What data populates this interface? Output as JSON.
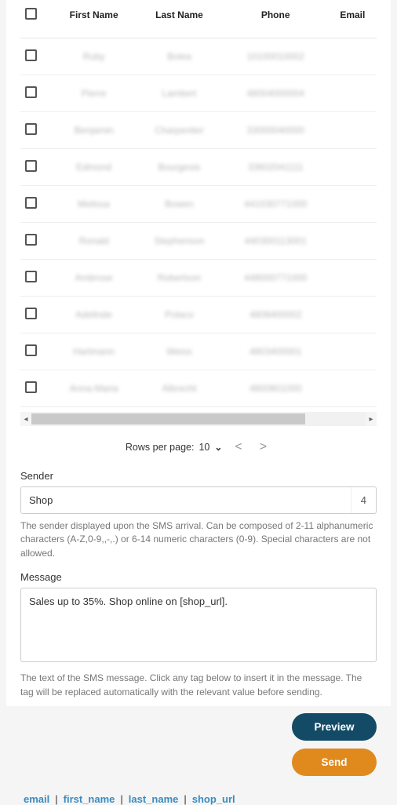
{
  "table": {
    "headers": {
      "first_name": "First Name",
      "last_name": "Last Name",
      "phone": "Phone",
      "email": "Email"
    },
    "rows": [
      {
        "first": "Ruby",
        "last": "Bolea",
        "phone": "10100010002",
        "email": ""
      },
      {
        "first": "Pierre",
        "last": "Lambert",
        "phone": "48004000004",
        "email": ""
      },
      {
        "first": "Benjamin",
        "last": "Charpentier",
        "phone": "33000040000",
        "email": ""
      },
      {
        "first": "Edmond",
        "last": "Bourgeois",
        "phone": "33602041111",
        "email": ""
      },
      {
        "first": "Melissa",
        "last": "Bowen",
        "phone": "441030771000",
        "email": ""
      },
      {
        "first": "Ronald",
        "last": "Stephenson",
        "phone": "440300113001",
        "email": ""
      },
      {
        "first": "Ambrose",
        "last": "Robertson",
        "phone": "448000771000",
        "email": ""
      },
      {
        "first": "Adelinde",
        "last": "Polaco",
        "phone": "4808400002",
        "email": ""
      },
      {
        "first": "Hartmann",
        "last": "Weiss",
        "phone": "4803400001",
        "email": ""
      },
      {
        "first": "Anna-Maria",
        "last": "Albrecht",
        "phone": "4800801000",
        "email": ""
      }
    ]
  },
  "pagination": {
    "rows_label": "Rows per page:",
    "rows_value": "10"
  },
  "sender": {
    "label": "Sender",
    "value": "Shop",
    "counter": "4",
    "help": "The sender displayed upon the SMS arrival. Can be composed of 2-11 alphanumeric characters (A-Z,0-9,,-,.) or 6-14 numeric characters (0-9). Special characters are not allowed."
  },
  "message": {
    "label": "Message",
    "value": "Sales up to 35%. Shop online on [shop_url].",
    "help": "The text of the SMS message. Click any tag below to insert it in the message. The tag will be replaced automatically with the relevant value before sending."
  },
  "buttons": {
    "preview": "Preview",
    "send": "Send"
  },
  "tags": [
    "email",
    "first_name",
    "last_name",
    "shop_url"
  ]
}
